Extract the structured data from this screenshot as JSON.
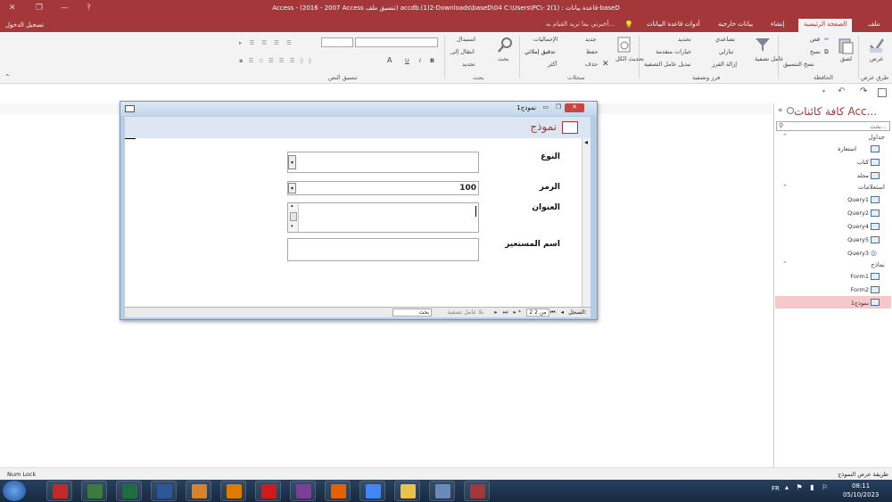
{
  "window": {
    "title": "Access - (2016 - 2007 Access تنسيق ملف) accdb.(1)2-Downloads\\baseD\\04 C:\\Users\\PC\\- قاعدة بيانات : (1)2-baseD"
  },
  "tabs": [
    "ملف",
    "الصفحة الرئيسية",
    "إنشاء",
    "بيانات خارجية",
    "أدوات قاعدة البيانات",
    "أخبرني بما تريد القيام به..."
  ],
  "signin": "تسجيل الدخول",
  "ribbon": {
    "views": {
      "btn": "عرض",
      "group": "طرق عرض"
    },
    "clipboard": {
      "paste": "لصق",
      "cut": "قص",
      "copy": "نسخ",
      "format": "نسخ التنسيق",
      "group": "الحافظة"
    },
    "sort": {
      "filter": "عامل تصفية",
      "asc": "تصاعدي",
      "desc": "تنازلي",
      "remove": "إزالة الفرز",
      "select": "تحديد",
      "advanced": "خيارات متقدمة",
      "toggle": "تبديل عامل التصفية",
      "group": "فرز وتصفية"
    },
    "records": {
      "refresh": "تحديث الكل",
      "new": "جديد",
      "save": "حفظ",
      "delete": "حذف",
      "totals": "الإجماليات",
      "spelling": "تدقيق إملائي",
      "more": "أكثر",
      "group": "سجلات"
    },
    "find": {
      "find": "بحث",
      "replace": "استبدال",
      "goto": "انتقال إلى",
      "select": "تحديد",
      "group": "بحث"
    },
    "text": {
      "group": "تنسيق النص",
      "b": "B",
      "i": "I",
      "u": "U",
      "a": "A"
    }
  },
  "nav": {
    "title": "كافة كائنات Acc...",
    "search": "بحث...",
    "groups": [
      {
        "name": "جداول",
        "items": [
          "استعارة",
          "كتاب",
          "مجلد"
        ]
      },
      {
        "name": "استعلامات",
        "items": [
          "Query1",
          "Query2",
          "Query4",
          "Query5",
          "Query3"
        ]
      },
      {
        "name": "نماذج",
        "items": [
          "Form1",
          "Form2",
          "نموذج1"
        ]
      }
    ]
  },
  "form": {
    "window_title": "نموذج1",
    "header_title": "نموذج",
    "fields": [
      {
        "label": "النوع",
        "value": ""
      },
      {
        "label": "الرمز",
        "value": "100"
      },
      {
        "label": "العنوان",
        "value": ""
      },
      {
        "label": "اسم المستعير",
        "value": ""
      }
    ],
    "nav": {
      "record_label": "السجل:",
      "position": "2 من 2",
      "filter": "بلا عامل تصفية",
      "search": "بحث"
    }
  },
  "status": {
    "left": "Num Lock",
    "right": "طريقة عرض النموذج"
  },
  "taskbar": {
    "lang": "FR",
    "time": "08:11",
    "date": "05/10/2023",
    "apps": [
      {
        "name": "acrobat",
        "color": "#c62828"
      },
      {
        "name": "network",
        "color": "#3d7a3d"
      },
      {
        "name": "excel",
        "color": "#1d6f42"
      },
      {
        "name": "word",
        "color": "#2b579a"
      },
      {
        "name": "publisher",
        "color": "#d9822b"
      },
      {
        "name": "torrent",
        "color": "#e07b00"
      },
      {
        "name": "opera",
        "color": "#d11b1b"
      },
      {
        "name": "winrar",
        "color": "#7b3f98"
      },
      {
        "name": "firefox",
        "color": "#e66000"
      },
      {
        "name": "chrome",
        "color": "#4285f4"
      },
      {
        "name": "explorer",
        "color": "#e8c24a"
      },
      {
        "name": "paint",
        "color": "#6a88b8"
      },
      {
        "name": "access",
        "color": "#a4373a"
      }
    ]
  }
}
